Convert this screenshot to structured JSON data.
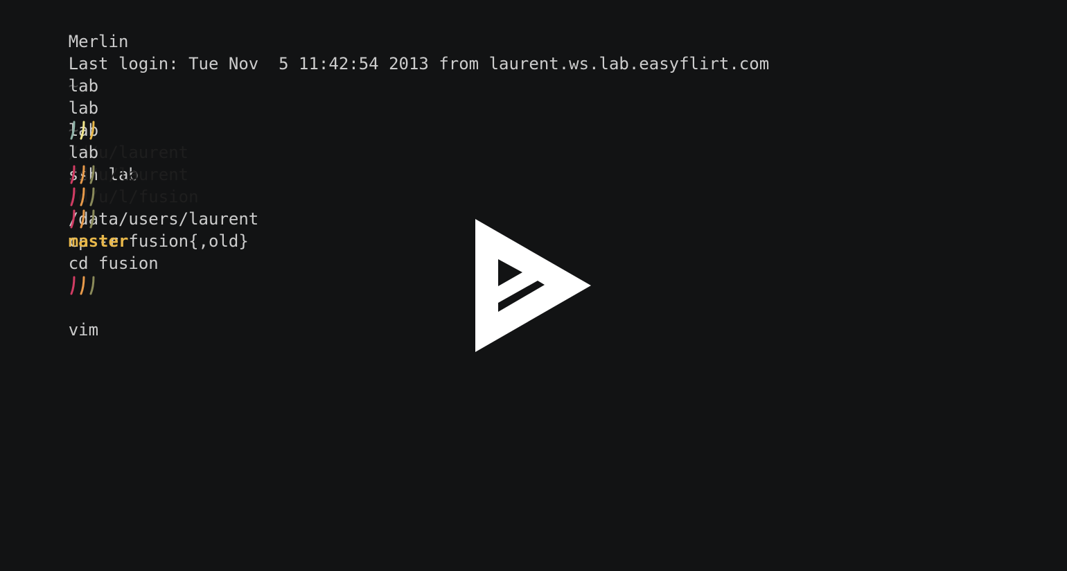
{
  "terminal": {
    "lines": [
      {
        "host": "Merlin",
        "path": "~",
        "command": "ssh lab",
        "glyph_colors": [
          "#8fb3a8",
          "#f2e68a",
          "#e8b84a"
        ]
      },
      {
        "text": "Last login: Tue Nov  5 11:42:54 2013 from laurent.ws.lab.easyflirt.com"
      },
      {
        "host": "lab",
        "path": "~",
        "command": "/data/users/laurent",
        "glyph_colors": [
          "#d13c64",
          "#e89a4a",
          "#8a8a5a"
        ]
      },
      {
        "host": "lab",
        "path": "/d/u/laurent",
        "command": "cp -r fusion{,old}",
        "glyph_colors": [
          "#d13c64",
          "#e89a4a",
          "#8a8a5a"
        ]
      },
      {
        "host": "lab",
        "path": "/d/u/laurent",
        "command": "cd fusion",
        "glyph_colors": [
          "#d13c64",
          "#e89a4a",
          "#8a8a5a"
        ]
      },
      {
        "host": "lab",
        "path": "/d/u/l/fusion",
        "branch": "master",
        "command": "vim",
        "glyph_colors": [
          "#d13c64",
          "#e89a4a",
          "#8a8a5a"
        ]
      }
    ],
    "colors": {
      "background": "#121314",
      "foreground": "#cccccc",
      "path_dim": "#1e1e1e",
      "tilde": "#4a4a4a",
      "branch": "#e8b84a"
    }
  },
  "player": {
    "play_icon": "asciinema-play-icon",
    "icon_color": "#ffffff"
  }
}
